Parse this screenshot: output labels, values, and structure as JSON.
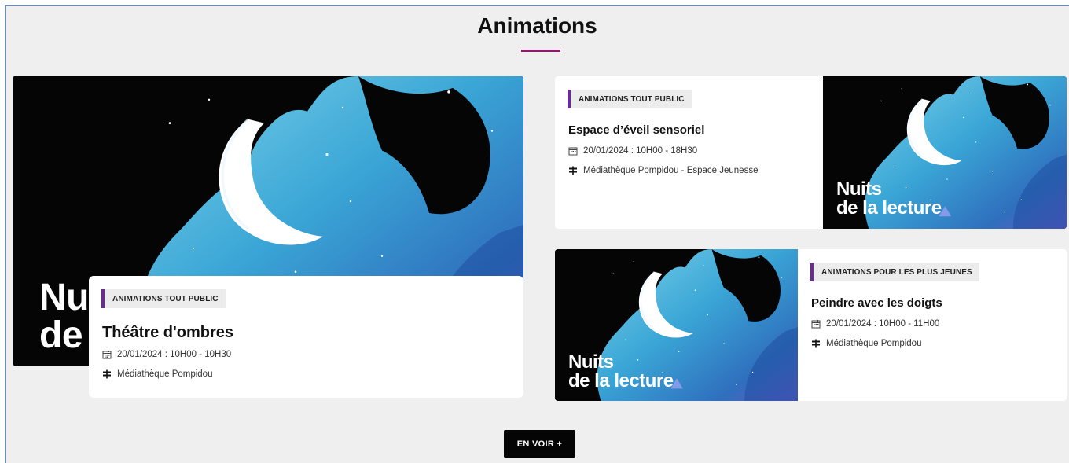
{
  "section": {
    "title": "Animations"
  },
  "illustration": {
    "line1": "Nuits",
    "line2": "de la lecture",
    "crop_line1": "Nu",
    "crop_line2": "de"
  },
  "featured": {
    "category": "ANIMATIONS TOUT PUBLIC",
    "title": "Théâtre d'ombres",
    "date": "20/01/2024 : 10H00 - 10H30",
    "location": "Médiathèque Pompidou"
  },
  "events": [
    {
      "category": "ANIMATIONS TOUT PUBLIC",
      "title": "Espace d’éveil sensoriel",
      "date": "20/01/2024 : 10H00 - 18H30",
      "location": "Médiathèque Pompidou - Espace Jeunesse"
    },
    {
      "category": "ANIMATIONS POUR LES PLUS JEUNES",
      "title": "Peindre avec les doigts",
      "date": "20/01/2024 : 10H00 - 11H00",
      "location": "Médiathèque Pompidou"
    }
  ],
  "more_button": {
    "label": "EN VOIR +"
  },
  "colors": {
    "accent": "#8a1d6a",
    "badge_bar": "#6b2a9a",
    "background": "#efefef"
  },
  "icons": {
    "date": "calendar-icon",
    "location": "signpost-icon"
  }
}
